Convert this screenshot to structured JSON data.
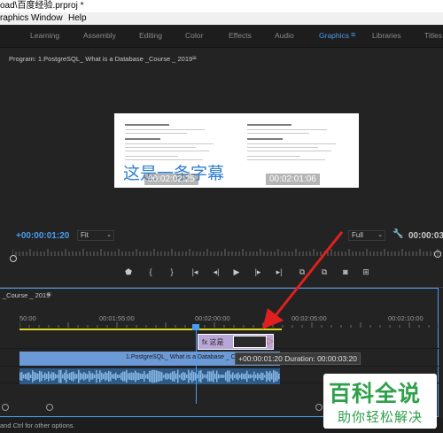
{
  "window": {
    "title": "oad\\百度经验.prproj *"
  },
  "menubar": {
    "items": [
      "raphics",
      "Window",
      "Help"
    ]
  },
  "workspaces": {
    "items": [
      "Learning",
      "Assembly",
      "Editing",
      "Color",
      "Effects",
      "Audio",
      "Graphics",
      "Libraries",
      "Titles"
    ],
    "active": "Graphics",
    "accent": "#4a9cf0"
  },
  "program_monitor": {
    "title": "Program: 1.PostgreSQL_ What is a Database _Course _ 2019",
    "subtitle_text": "这是一条字幕",
    "overlay_timecode_left": "00:02:02:25",
    "overlay_timecode_right": "00:02:01:06",
    "current_timecode": "+00:00:01:20",
    "fit_label": "Fit",
    "quality_label": "Full",
    "duration_timecode": "00:00:03"
  },
  "transport": {
    "icons": [
      "marker-icon",
      "in-point-icon",
      "out-point-icon",
      "go-to-in-icon",
      "step-back-icon",
      "play-icon",
      "step-forward-icon",
      "go-to-out-icon",
      "lift-icon",
      "extract-icon",
      "export-frame-icon",
      "more-icon"
    ]
  },
  "timeline": {
    "tab_title": "_Course _ 2019",
    "ruler_labels": [
      "50:00",
      "00:01:55:00",
      "00:02:00:00",
      "00:02:05:00",
      "00:02:10:00"
    ],
    "graphic_clip_label": "fx 这是",
    "video_clip_label": "1.PostgreSQL_ What is a Database _ Course",
    "tooltip_text": "+00:00:01:20  Duration: 00:00:03:20",
    "clip_colors": {
      "graphic": "#b8a6d6",
      "video": "#6c9ad6",
      "audio": "#2d5a86",
      "work_area": "#d8d820"
    }
  },
  "status_bar": {
    "text": "and Ctrl for other options."
  },
  "watermark": {
    "line1": "百科全说",
    "line2": "助你轻松解决",
    "color": "#2ea04a"
  }
}
